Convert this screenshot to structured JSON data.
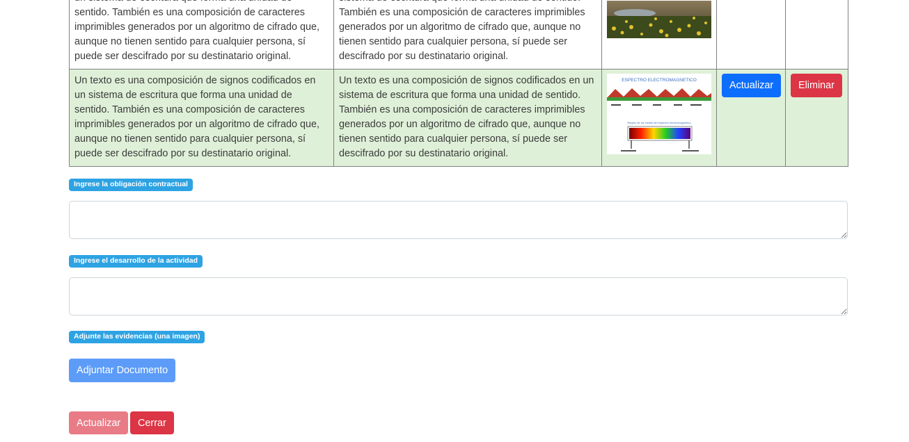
{
  "table": {
    "rows": [
      {
        "col1": "Un texto es una composición de signos codificados en un sistema de escritura que forma una unidad de sentido. También es una composición de caracteres imprimibles generados por un algoritmo de cifrado que, aunque no tienen sentido para cualquier persona, sí puede ser descifrado por su destinatario original.",
        "col2": "Un texto es una composición de signos codificados en un sistema de escritura que forma una unidad de sentido. También es una composición de caracteres imprimibles generados por un algoritmo de cifrado que, aunque no tienen sentido para cualquier persona, sí puede ser descifrado por su destinatario original."
      },
      {
        "col1": "Un texto es una composición de signos codificados en un sistema de escritura que forma una unidad de sentido. También es una composición de caracteres imprimibles generados por un algoritmo de cifrado que, aunque no tienen sentido para cualquier persona, sí puede ser descifrado por su destinatario original.",
        "col2": "Un texto es una composición de signos codificados en un sistema de escritura que forma una unidad de sentido. También es una composición de caracteres imprimibles generados por un algoritmo de cifrado que, aunque no tienen sentido para cualquier persona, sí puede ser descifrado por su destinatario original.",
        "image_title": "ESPECTRO ELECTROMAGNETICO",
        "image_caption": "Región de luz visible del espectro electromagnético",
        "update_label": "Actualizar",
        "delete_label": "Eliminar"
      }
    ]
  },
  "form": {
    "obligation_label": "Ingrese la obligación contractual",
    "obligation_value": "",
    "activity_label": "Ingrese el desarrollo de la actividad",
    "activity_value": "",
    "evidence_label": "Adjunte las evidencias (una imagen)",
    "attach_label": "Adjuntar Documento",
    "update_label": "Actualizar",
    "close_label": "Cerrar"
  },
  "colors": {
    "primary": "#0d6efd",
    "danger": "#dc3545",
    "badge": "#2ea3e3",
    "row_highlight": "#dff0d8"
  }
}
